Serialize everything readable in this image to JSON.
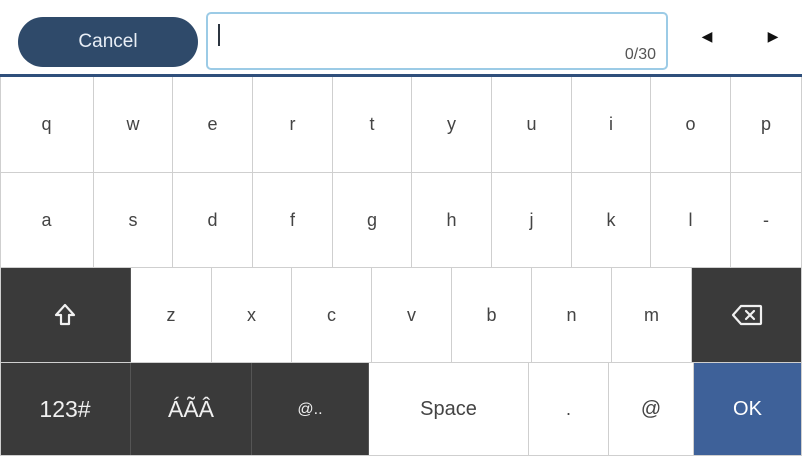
{
  "toolbar": {
    "cancel_label": "Cancel",
    "input_value": "",
    "char_counter": "0/30",
    "left_arrow": "◀",
    "right_arrow": "▶"
  },
  "keyboard": {
    "row1": [
      "q",
      "w",
      "e",
      "r",
      "t",
      "y",
      "u",
      "i",
      "o",
      "p"
    ],
    "row2": [
      "a",
      "s",
      "d",
      "f",
      "g",
      "h",
      "j",
      "k",
      "l",
      "-"
    ],
    "row3_letters": [
      "z",
      "x",
      "c",
      "v",
      "b",
      "n",
      "m"
    ],
    "shift_icon": "shift-arrow-icon",
    "backspace_icon": "backspace-icon",
    "bottom": {
      "numbers_label": "123#",
      "accents_label": "ÁÃÂ",
      "symbols_label": "@..",
      "space_label": "Space",
      "dot_label": ".",
      "at_label": "@",
      "ok_label": "OK"
    }
  },
  "colors": {
    "dark_key": "#3a3a3a",
    "cancel_button": "#2f4a6a",
    "ok_button": "#3e6199",
    "input_border": "#9ccbe6"
  }
}
